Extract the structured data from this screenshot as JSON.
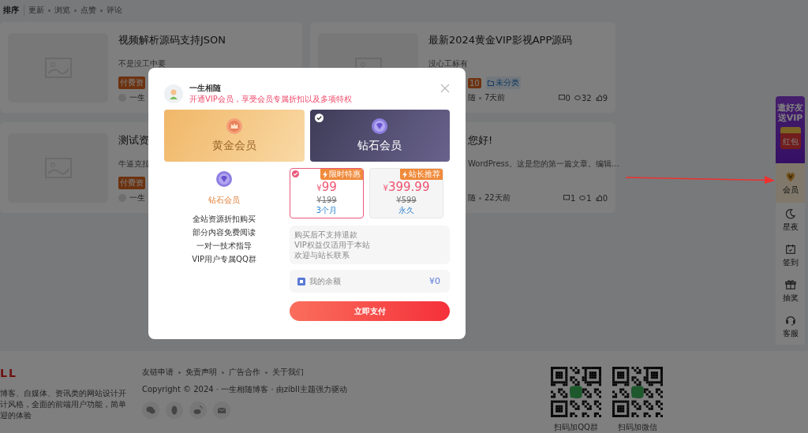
{
  "sort_bar": {
    "label": "排序",
    "options": [
      "更新",
      "浏览",
      "点赞",
      "评论"
    ]
  },
  "posts": [
    {
      "title": "视频解析源码支持JSON",
      "excerpt": "不是没工中要",
      "tags": [
        {
          "text": "付费资",
          "kind": "paid"
        }
      ],
      "author": "一生"
    },
    {
      "title": "最新2024黄金VIP影视APP源码",
      "excerpt": "没心工标有",
      "tags": [
        {
          "text": "10",
          "kind": "paid"
        },
        {
          "text": "未分类",
          "kind": "category"
        }
      ],
      "author": "随",
      "time": "7天前",
      "stats": [
        "0",
        "32",
        "9"
      ]
    },
    {
      "title": "测试资",
      "excerpt": "牛逼克拉",
      "tags": [
        {
          "text": "付费资",
          "kind": "paid"
        }
      ],
      "author": "一生"
    },
    {
      "title": "您好!",
      "excerpt": "WordPress。这是您的第一篇文章。编辑...",
      "author": "随",
      "time": "22天前",
      "stats": [
        "1",
        "1",
        "0"
      ]
    }
  ],
  "float_bar": [
    {
      "kind": "promo",
      "title": "邀好友送VIP",
      "badge": "红包"
    },
    {
      "kind": "vip",
      "label": "会员",
      "selected": true
    },
    {
      "kind": "moon",
      "label": "星夜",
      "selected": false
    },
    {
      "kind": "calendar",
      "label": "签到",
      "selected": false
    },
    {
      "kind": "gift",
      "label": "抽奖",
      "selected": false
    },
    {
      "kind": "headset",
      "label": "客服",
      "selected": false
    }
  ],
  "footer": {
    "logo": "LL",
    "description": [
      "博客、自媒体、资讯类的网站设计开",
      "计风格，全面的前端用户功能，简单",
      "迎的体验"
    ],
    "links": [
      "友链申请",
      "免责声明",
      "广告合作",
      "关于我们"
    ],
    "copyright": "Copyright © 2024 · 一生相随博客 · 由zibll主题强力驱动",
    "qr_codes": [
      "扫码加QQ群",
      "扫码加微信"
    ]
  },
  "modal": {
    "user": {
      "name": "一生相随",
      "subtitle": "开通VIP会员，享受会员专属折扣以及多项特权"
    },
    "tiers": [
      {
        "name": "黄金会员",
        "kind": "gold",
        "selected": false
      },
      {
        "name": "钻石会员",
        "kind": "diamond",
        "selected": true
      }
    ],
    "benefits": {
      "title": "钻石会员",
      "items": [
        "全站资源折扣购买",
        "部分内容免费阅读",
        "一对一技术指导",
        "VIP用户专属QQ群"
      ]
    },
    "plans": [
      {
        "badge": "限时特惠",
        "currency": "¥",
        "amount": "99",
        "original": "¥199",
        "period": "3个月",
        "selected": true
      },
      {
        "badge": "站长推荐",
        "currency": "¥",
        "amount": "399.99",
        "original": "¥599",
        "period": "永久",
        "selected": false
      }
    ],
    "notes": [
      "购买后不支持退款",
      "VIP权益仅适用于本站",
      "欢迎与站长联系"
    ],
    "balance": {
      "label": "我的余额",
      "value": "¥0"
    },
    "pay_button": "立即支付"
  }
}
